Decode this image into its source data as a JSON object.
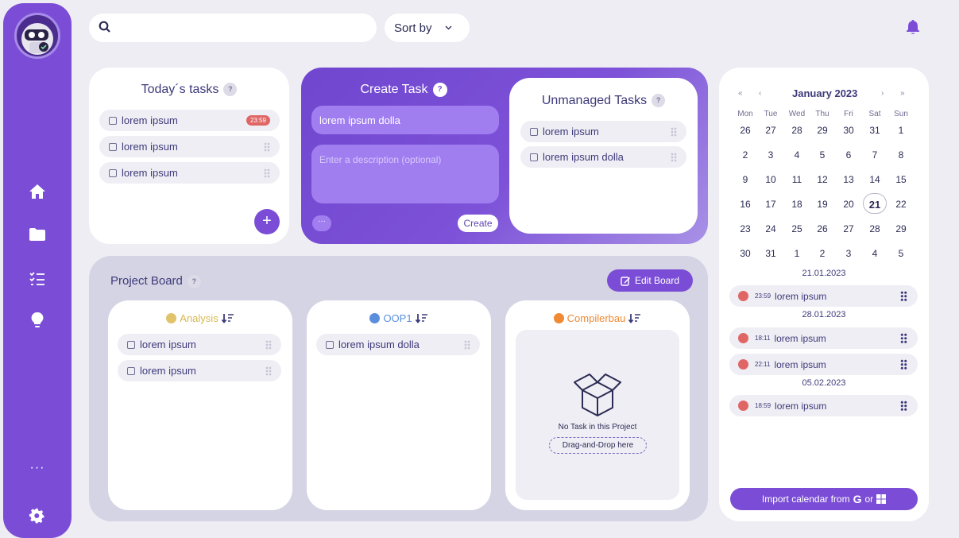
{
  "search": {
    "placeholder": "",
    "value": ""
  },
  "sort": {
    "label": "Sort by"
  },
  "today": {
    "title": "Today´s tasks",
    "help": "?",
    "items": [
      {
        "label": "lorem ipsum",
        "badge": "23:59"
      },
      {
        "label": "lorem ipsum"
      },
      {
        "label": "lorem ipsum"
      }
    ],
    "add_label": "+"
  },
  "create": {
    "title": "Create Task",
    "help": "?",
    "name_value": "lorem ipsum dolla",
    "description_placeholder": "Enter a description (optional)",
    "more_label": "···",
    "create_label": "Create"
  },
  "unmanaged": {
    "title": "Unmanaged Tasks",
    "help": "?",
    "items": [
      {
        "label": "lorem ipsum"
      },
      {
        "label": "lorem ipsum dolla"
      }
    ]
  },
  "board": {
    "title": "Project Board",
    "help": "?",
    "edit_label": "Edit Board",
    "columns": [
      {
        "name": "Analysis",
        "color": "#e0c36a",
        "items": [
          "lorem ipsum",
          "lorem ipsum"
        ]
      },
      {
        "name": "OOP1",
        "color": "#5b8fde",
        "items": [
          "lorem ipsum dolla"
        ]
      },
      {
        "name": "Compilerbau",
        "color": "#f08a35",
        "items": [],
        "empty_text": "No Task in this Project",
        "dnd_text": "Drag-and-Drop here"
      }
    ]
  },
  "calendar": {
    "nav": {
      "prev_year": "«",
      "prev_month": "‹",
      "next_month": "›",
      "next_year": "»"
    },
    "month": "January 2023",
    "weekdays": [
      "Mon",
      "Tue",
      "Wed",
      "Thu",
      "Fri",
      "Sat",
      "Sun"
    ],
    "weeks": [
      [
        "26",
        "27",
        "28",
        "29",
        "30",
        "31",
        "1"
      ],
      [
        "2",
        "3",
        "4",
        "5",
        "6",
        "7",
        "8"
      ],
      [
        "9",
        "10",
        "11",
        "12",
        "13",
        "14",
        "15"
      ],
      [
        "16",
        "17",
        "18",
        "19",
        "20",
        "21",
        "22"
      ],
      [
        "23",
        "24",
        "25",
        "26",
        "27",
        "28",
        "29"
      ],
      [
        "30",
        "31",
        "1",
        "2",
        "3",
        "4",
        "5"
      ]
    ],
    "today": "21",
    "events": [
      {
        "date": "21.01.2023",
        "items": [
          {
            "time": "23:59",
            "label": "lorem ipsum"
          }
        ]
      },
      {
        "date": "28.01.2023",
        "items": [
          {
            "time": "18:11",
            "label": "lorem ipsum"
          },
          {
            "time": "22:11",
            "label": "lorem ipsum"
          }
        ]
      },
      {
        "date": "05.02.2023",
        "items": [
          {
            "time": "18:59",
            "label": "lorem ipsum"
          }
        ]
      }
    ],
    "import_label": "Import calendar from",
    "import_or": "or"
  },
  "sidebar": {
    "more_label": "···"
  },
  "colors": {
    "accent": "#7b4dd6",
    "badge": "#e06666",
    "background": "#eeedf4"
  }
}
